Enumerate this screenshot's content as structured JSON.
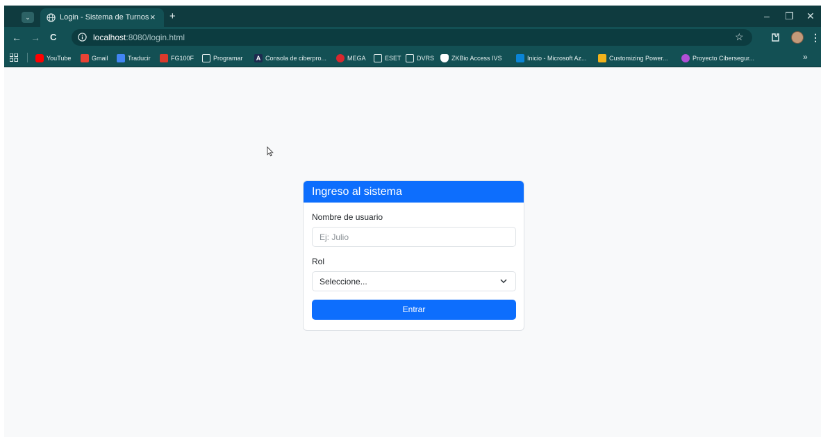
{
  "browser": {
    "tab": {
      "title": "Login - Sistema de Turnos",
      "close": "×"
    },
    "new_tab": "+",
    "window": {
      "minimize": "–",
      "restore": "❐",
      "close": "✕"
    },
    "nav": {
      "back": "←",
      "forward": "→",
      "reload": "C",
      "star": "☆"
    },
    "url": {
      "host": "localhost",
      "rest": ":8080/login.html"
    },
    "bookmarks": [
      {
        "label": "YouTube",
        "icon": "youtube-icon",
        "color": "#ff0000"
      },
      {
        "label": "Gmail",
        "icon": "gmail-icon",
        "color": "#ea4335"
      },
      {
        "label": "Traducir",
        "icon": "translate-icon",
        "color": "#4285f4"
      },
      {
        "label": "FG100F",
        "icon": "fortinet-icon",
        "color": "#da3a2c"
      },
      {
        "label": "Programar",
        "icon": "folder-icon",
        "color": "#135054"
      },
      {
        "label": "Consola de ciberpro...",
        "icon": "console-icon",
        "color": "#1d2b4f"
      },
      {
        "label": "MEGA",
        "icon": "mega-icon",
        "color": "#d9272e"
      },
      {
        "label": "ESET",
        "icon": "folder-icon",
        "color": "#135054"
      },
      {
        "label": "DVRS",
        "icon": "folder-icon",
        "color": "#135054"
      },
      {
        "label": "ZKBio Access IVS",
        "icon": "shield-icon",
        "color": "#ffffff"
      },
      {
        "label": "Inicio - Microsoft Az...",
        "icon": "azure-icon",
        "color": "#0a84d6"
      },
      {
        "label": "Customizing Power...",
        "icon": "power-icon",
        "color": "#f2b21b"
      },
      {
        "label": "Proyecto Cibersegur...",
        "icon": "proyecto-icon",
        "color": "#b04fd6"
      }
    ],
    "bookmarks_more": "»"
  },
  "login": {
    "header": "Ingreso al sistema",
    "username_label": "Nombre de usuario",
    "username_placeholder": "Ej: Julio",
    "role_label": "Rol",
    "role_selected": "Seleccione...",
    "submit_label": "Entrar"
  },
  "colors": {
    "primary": "#0d6efd",
    "browser_frame": "#135054",
    "page_bg": "#f8f9fa"
  }
}
